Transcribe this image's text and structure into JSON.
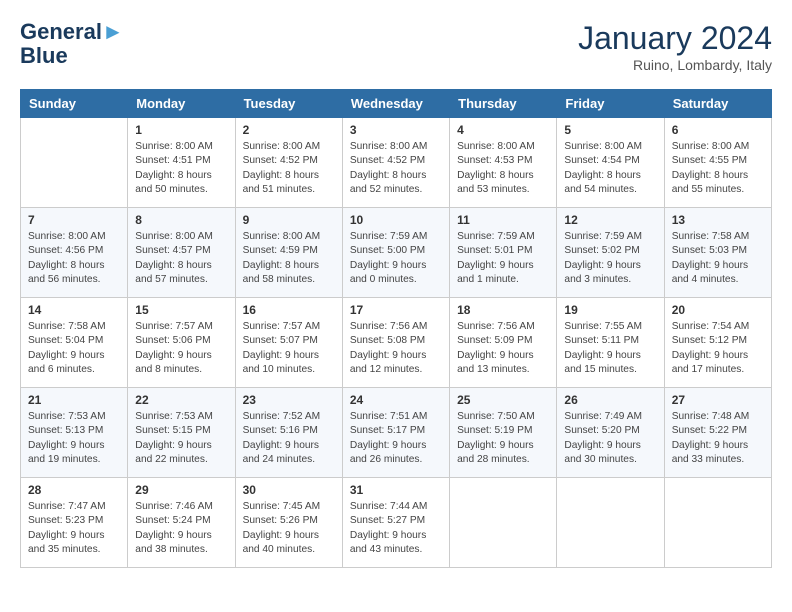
{
  "header": {
    "logo_line1": "General",
    "logo_line2": "Blue",
    "month": "January 2024",
    "location": "Ruino, Lombardy, Italy"
  },
  "weekdays": [
    "Sunday",
    "Monday",
    "Tuesday",
    "Wednesday",
    "Thursday",
    "Friday",
    "Saturday"
  ],
  "weeks": [
    [
      {
        "day": "",
        "text": ""
      },
      {
        "day": "1",
        "text": "Sunrise: 8:00 AM\nSunset: 4:51 PM\nDaylight: 8 hours\nand 50 minutes."
      },
      {
        "day": "2",
        "text": "Sunrise: 8:00 AM\nSunset: 4:52 PM\nDaylight: 8 hours\nand 51 minutes."
      },
      {
        "day": "3",
        "text": "Sunrise: 8:00 AM\nSunset: 4:52 PM\nDaylight: 8 hours\nand 52 minutes."
      },
      {
        "day": "4",
        "text": "Sunrise: 8:00 AM\nSunset: 4:53 PM\nDaylight: 8 hours\nand 53 minutes."
      },
      {
        "day": "5",
        "text": "Sunrise: 8:00 AM\nSunset: 4:54 PM\nDaylight: 8 hours\nand 54 minutes."
      },
      {
        "day": "6",
        "text": "Sunrise: 8:00 AM\nSunset: 4:55 PM\nDaylight: 8 hours\nand 55 minutes."
      }
    ],
    [
      {
        "day": "7",
        "text": "Sunrise: 8:00 AM\nSunset: 4:56 PM\nDaylight: 8 hours\nand 56 minutes."
      },
      {
        "day": "8",
        "text": "Sunrise: 8:00 AM\nSunset: 4:57 PM\nDaylight: 8 hours\nand 57 minutes."
      },
      {
        "day": "9",
        "text": "Sunrise: 8:00 AM\nSunset: 4:59 PM\nDaylight: 8 hours\nand 58 minutes."
      },
      {
        "day": "10",
        "text": "Sunrise: 7:59 AM\nSunset: 5:00 PM\nDaylight: 9 hours\nand 0 minutes."
      },
      {
        "day": "11",
        "text": "Sunrise: 7:59 AM\nSunset: 5:01 PM\nDaylight: 9 hours\nand 1 minute."
      },
      {
        "day": "12",
        "text": "Sunrise: 7:59 AM\nSunset: 5:02 PM\nDaylight: 9 hours\nand 3 minutes."
      },
      {
        "day": "13",
        "text": "Sunrise: 7:58 AM\nSunset: 5:03 PM\nDaylight: 9 hours\nand 4 minutes."
      }
    ],
    [
      {
        "day": "14",
        "text": "Sunrise: 7:58 AM\nSunset: 5:04 PM\nDaylight: 9 hours\nand 6 minutes."
      },
      {
        "day": "15",
        "text": "Sunrise: 7:57 AM\nSunset: 5:06 PM\nDaylight: 9 hours\nand 8 minutes."
      },
      {
        "day": "16",
        "text": "Sunrise: 7:57 AM\nSunset: 5:07 PM\nDaylight: 9 hours\nand 10 minutes."
      },
      {
        "day": "17",
        "text": "Sunrise: 7:56 AM\nSunset: 5:08 PM\nDaylight: 9 hours\nand 12 minutes."
      },
      {
        "day": "18",
        "text": "Sunrise: 7:56 AM\nSunset: 5:09 PM\nDaylight: 9 hours\nand 13 minutes."
      },
      {
        "day": "19",
        "text": "Sunrise: 7:55 AM\nSunset: 5:11 PM\nDaylight: 9 hours\nand 15 minutes."
      },
      {
        "day": "20",
        "text": "Sunrise: 7:54 AM\nSunset: 5:12 PM\nDaylight: 9 hours\nand 17 minutes."
      }
    ],
    [
      {
        "day": "21",
        "text": "Sunrise: 7:53 AM\nSunset: 5:13 PM\nDaylight: 9 hours\nand 19 minutes."
      },
      {
        "day": "22",
        "text": "Sunrise: 7:53 AM\nSunset: 5:15 PM\nDaylight: 9 hours\nand 22 minutes."
      },
      {
        "day": "23",
        "text": "Sunrise: 7:52 AM\nSunset: 5:16 PM\nDaylight: 9 hours\nand 24 minutes."
      },
      {
        "day": "24",
        "text": "Sunrise: 7:51 AM\nSunset: 5:17 PM\nDaylight: 9 hours\nand 26 minutes."
      },
      {
        "day": "25",
        "text": "Sunrise: 7:50 AM\nSunset: 5:19 PM\nDaylight: 9 hours\nand 28 minutes."
      },
      {
        "day": "26",
        "text": "Sunrise: 7:49 AM\nSunset: 5:20 PM\nDaylight: 9 hours\nand 30 minutes."
      },
      {
        "day": "27",
        "text": "Sunrise: 7:48 AM\nSunset: 5:22 PM\nDaylight: 9 hours\nand 33 minutes."
      }
    ],
    [
      {
        "day": "28",
        "text": "Sunrise: 7:47 AM\nSunset: 5:23 PM\nDaylight: 9 hours\nand 35 minutes."
      },
      {
        "day": "29",
        "text": "Sunrise: 7:46 AM\nSunset: 5:24 PM\nDaylight: 9 hours\nand 38 minutes."
      },
      {
        "day": "30",
        "text": "Sunrise: 7:45 AM\nSunset: 5:26 PM\nDaylight: 9 hours\nand 40 minutes."
      },
      {
        "day": "31",
        "text": "Sunrise: 7:44 AM\nSunset: 5:27 PM\nDaylight: 9 hours\nand 43 minutes."
      },
      {
        "day": "",
        "text": ""
      },
      {
        "day": "",
        "text": ""
      },
      {
        "day": "",
        "text": ""
      }
    ]
  ]
}
